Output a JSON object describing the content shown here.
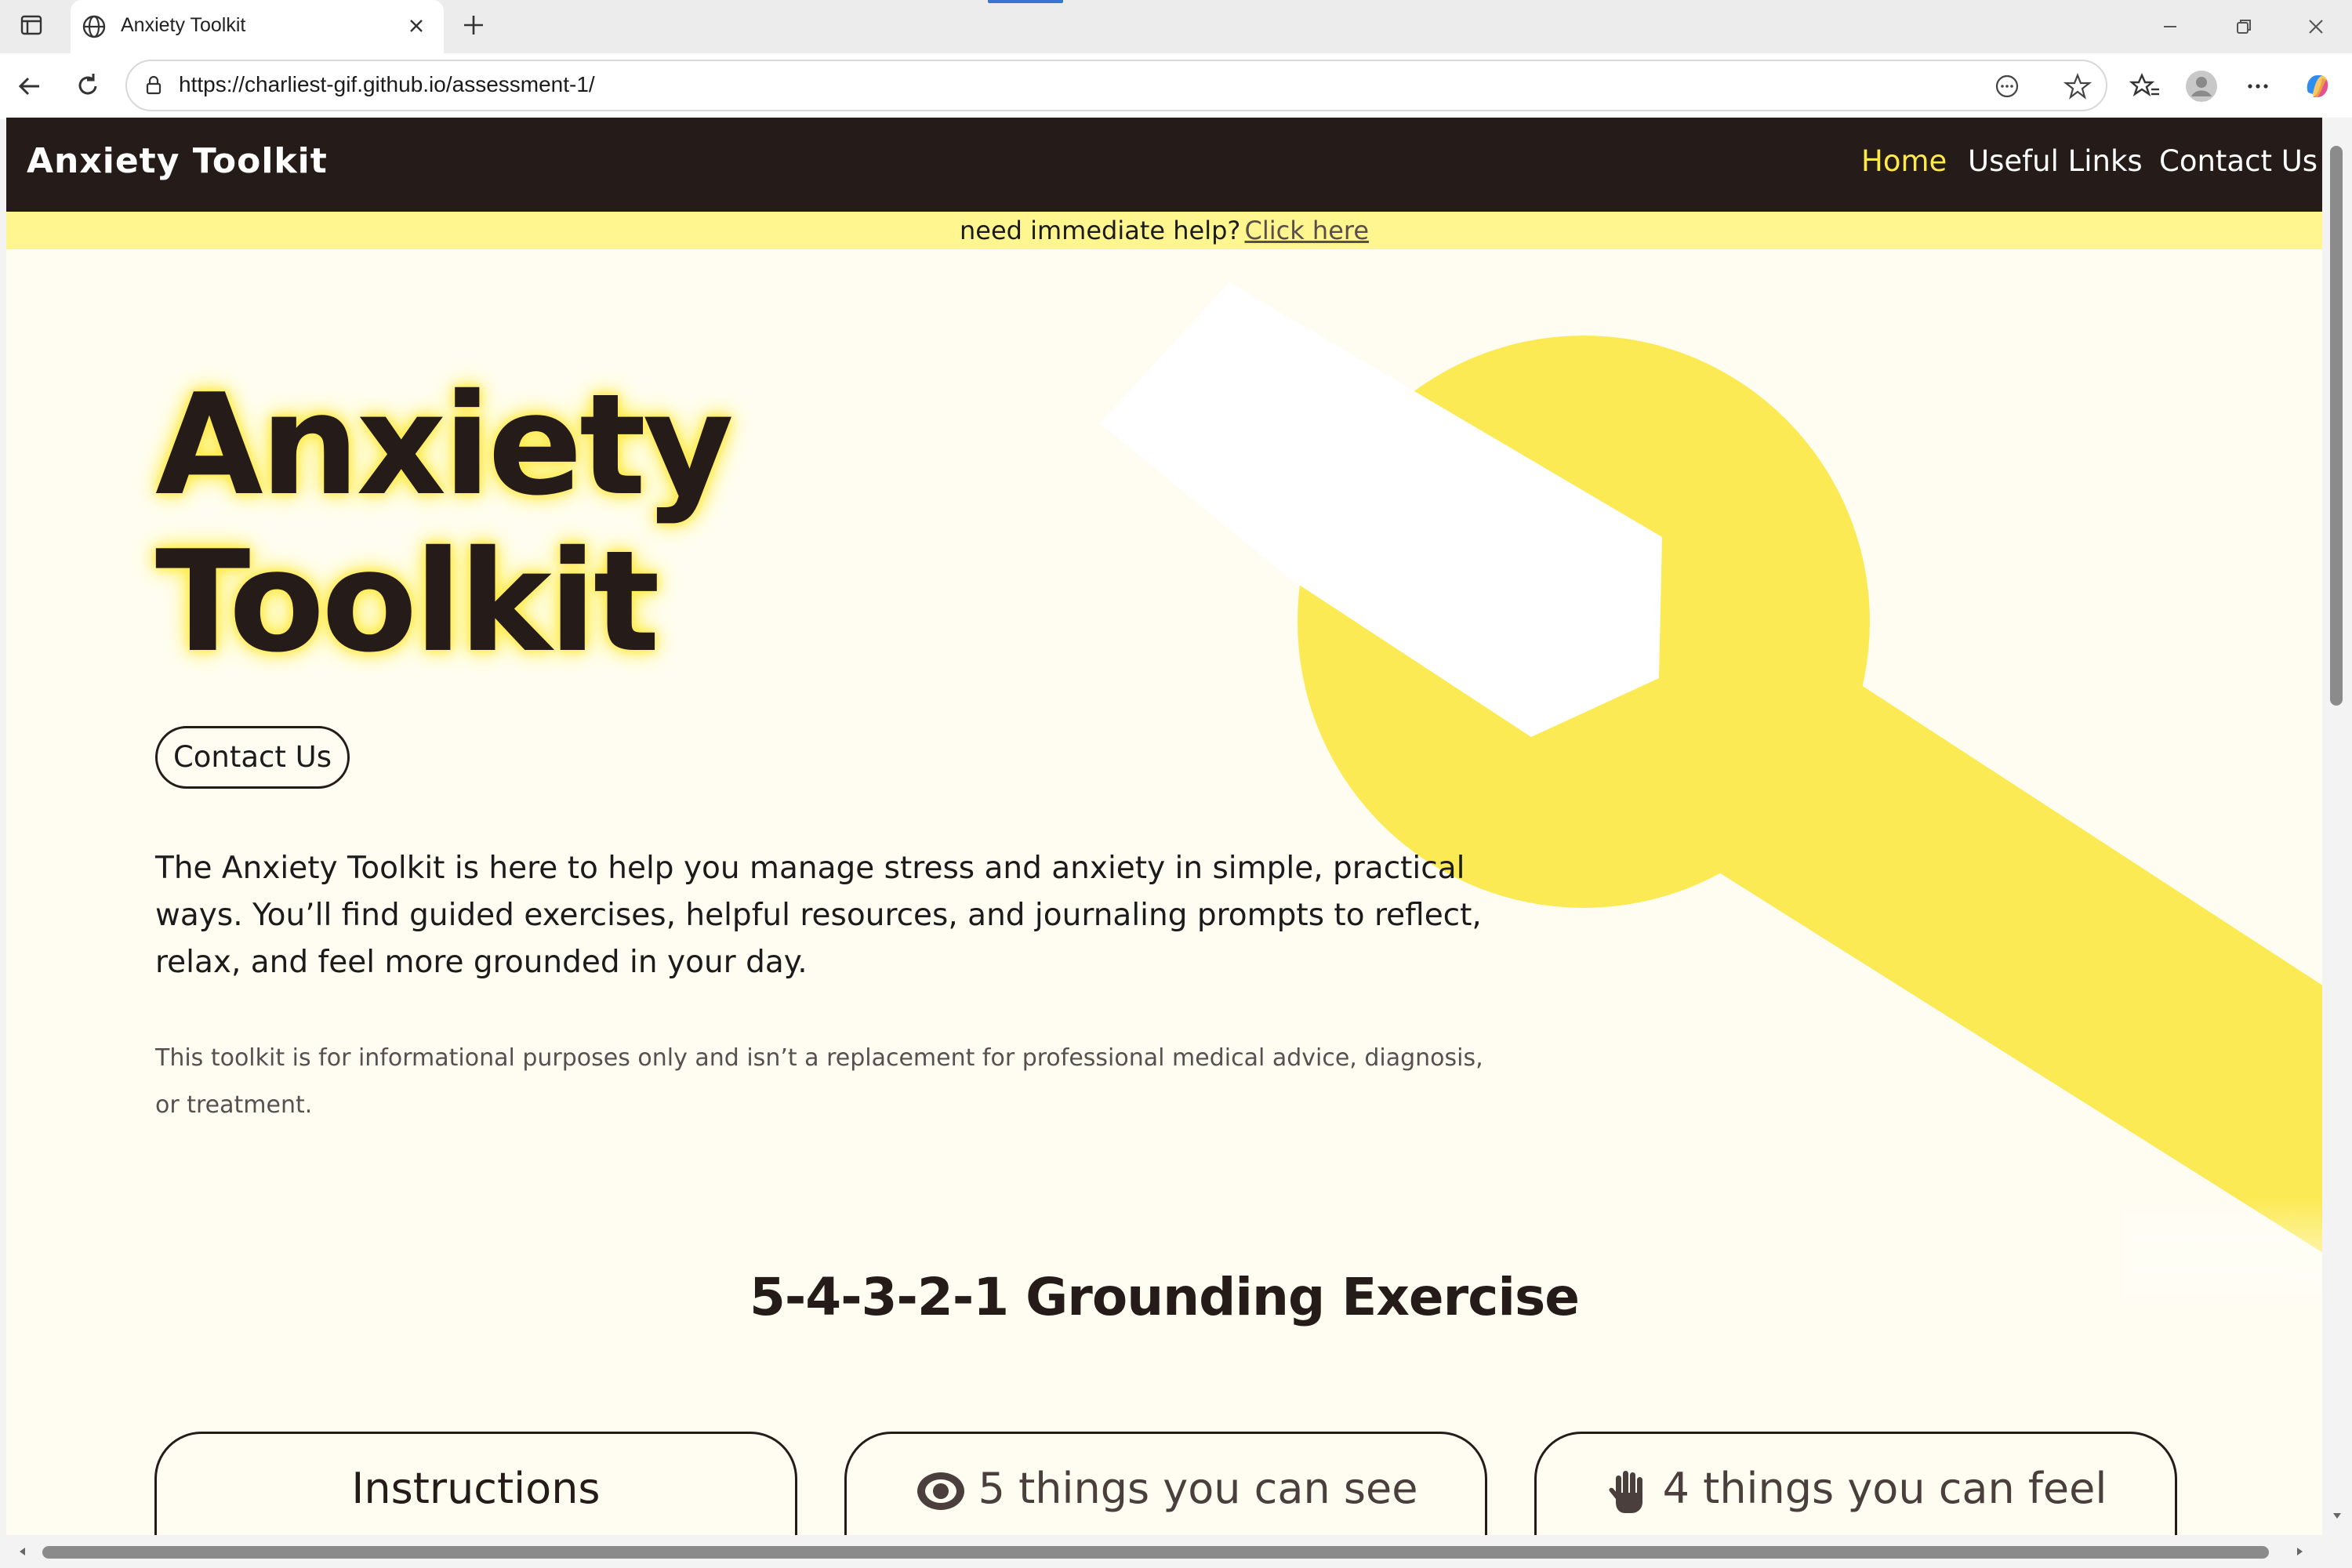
{
  "browser": {
    "tab_title": "Anxiety Toolkit",
    "url": "https://charliest-gif.github.io/assessment-1/",
    "icons": [
      "sidebar-icon",
      "globe-icon",
      "close-icon",
      "plus-icon",
      "minimize-icon",
      "restore-icon",
      "window-close-icon",
      "back-icon",
      "refresh-icon",
      "lock-icon",
      "reader-icon",
      "star-icon",
      "favorites-icon",
      "profile-icon",
      "more-icon",
      "copilot-icon"
    ]
  },
  "site": {
    "logo": "Anxiety Toolkit",
    "nav": [
      "Home",
      "Useful Links",
      "Contact Us"
    ],
    "help_text": "need immediate help?",
    "help_link": "Click here",
    "accent_yellow": "#ffe94a",
    "dark": "#251c1a"
  },
  "hero": {
    "title_line1": "Anxiety",
    "title_line2": "Toolkit",
    "contact_button": "Contact Us",
    "intro": "The Anxiety Toolkit is here to help you manage stress and anxiety in simple, practical ways. You’ll find guided exercises, helpful resources, and journaling prompts to reflect, relax, and feel more grounded in your day.",
    "disclaimer": "This toolkit is for informational purposes only and isn’t a replacement for professional medical advice, diagnosis, or treatment."
  },
  "exercise": {
    "title": "5-4-3-2-1 Grounding Exercise",
    "cards": [
      {
        "label": "Instructions",
        "icon": ""
      },
      {
        "label": "5 things you can see",
        "icon": "eye-icon"
      },
      {
        "label": "4 things you can feel",
        "icon": "hand-icon"
      }
    ]
  }
}
